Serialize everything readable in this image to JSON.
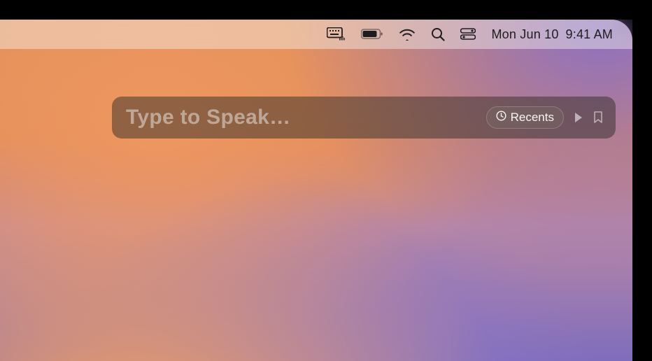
{
  "menubar": {
    "date": "Mon Jun 10",
    "time": "9:41 AM"
  },
  "speech_panel": {
    "placeholder": "Type to Speak…",
    "recents_label": "Recents"
  }
}
